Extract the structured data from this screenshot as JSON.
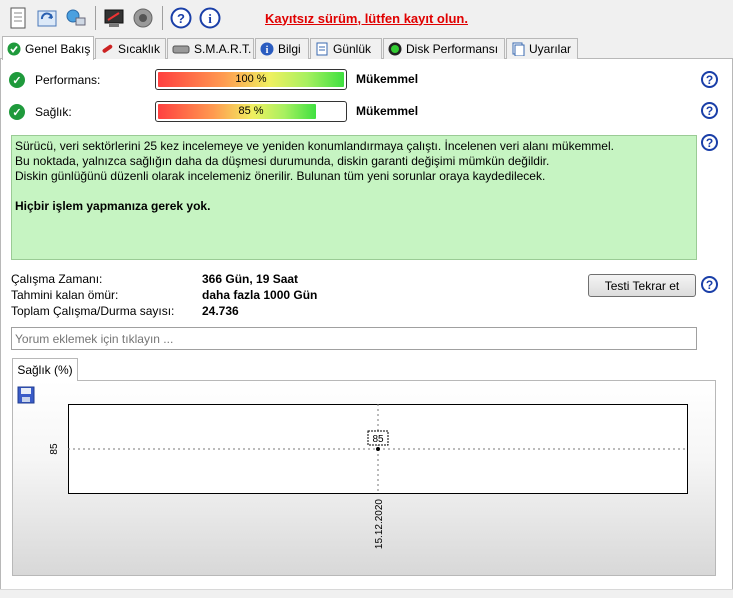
{
  "toolbar": {
    "icons": [
      "document-icon",
      "refresh-icon",
      "network-icon",
      "screen-icon",
      "speaker-icon",
      "help-icon",
      "info-icon"
    ],
    "unregistered_text": "Kayıtsız sürüm, lütfen kayıt olun."
  },
  "tabs": [
    {
      "label": "Genel Bakış",
      "icon": "check-icon",
      "active": true
    },
    {
      "label": "Sıcaklık",
      "icon": "thermometer-icon"
    },
    {
      "label": "S.M.A.R.T.",
      "icon": "drive-icon"
    },
    {
      "label": "Bilgi",
      "icon": "info-icon"
    },
    {
      "label": "Günlük",
      "icon": "log-icon"
    },
    {
      "label": "Disk Performansı",
      "icon": "gauge-icon"
    },
    {
      "label": "Uyarılar",
      "icon": "alerts-icon"
    }
  ],
  "status": {
    "performance": {
      "label": "Performans:",
      "percent_text": "100 %",
      "value": 100,
      "grade": "Mükemmel"
    },
    "health": {
      "label": "Sağlık:",
      "percent_text": "85 %",
      "value": 85,
      "grade": "Mükemmel"
    }
  },
  "message": {
    "lines": [
      "Sürücü, veri sektörlerini 25 kez incelemeye ve yeniden konumlandırmaya çalıştı. İncelenen veri alanı mükemmel.",
      "Bu noktada, yalnızca sağlığın daha da düşmesi durumunda, diskin garanti değişimi mümkün değildir.",
      "Diskin günlüğünü düzenli olarak incelemeniz önerilir. Bulunan tüm yeni sorunlar oraya kaydedilecek."
    ],
    "bold_line": "Hiçbir işlem yapmanıza gerek yok."
  },
  "info": {
    "uptime_label": "Çalışma Zamanı:",
    "uptime_value": "366 Gün, 19 Saat",
    "lifetime_label": "Tahmini kalan ömür:",
    "lifetime_value": "daha fazla 1000 Gün",
    "startstop_label": "Toplam Çalışma/Durma sayısı:",
    "startstop_value": "24.736"
  },
  "retest_button": "Testi Tekrar et",
  "comment_placeholder": "Yorum eklemek için tıklayın ...",
  "chart_tab": "Sağlık (%)",
  "chart_data": {
    "type": "line",
    "x": [
      "15.12.2020"
    ],
    "series": [
      {
        "values": [
          85
        ]
      }
    ],
    "ylabel_tick": "85",
    "xlabel_tick": "15.12.2020",
    "data_label": "85",
    "grid": true
  }
}
